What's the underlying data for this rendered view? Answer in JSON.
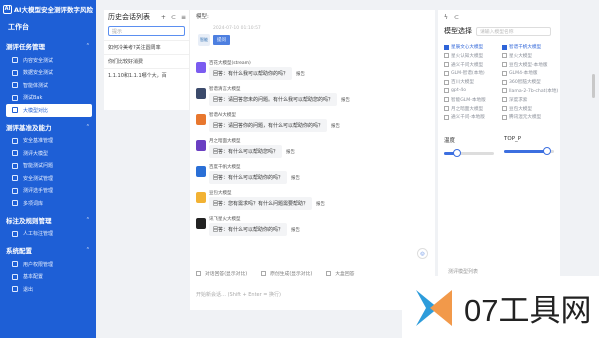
{
  "brand": {
    "logo_text": "AI",
    "title": "AI大模型安全测评数字风险"
  },
  "workbench": "工作台",
  "sidebar": {
    "groups": [
      {
        "title": "测评任务管理",
        "items": [
          {
            "label": "内容安全测试"
          },
          {
            "label": "数据安全测试"
          },
          {
            "label": "智能体测试"
          },
          {
            "label": "测试Bak"
          },
          {
            "label": "大模型对比",
            "active": true
          }
        ]
      },
      {
        "title": "测评基准及能力",
        "items": [
          {
            "label": "安全基准管理"
          },
          {
            "label": "测评大模型"
          },
          {
            "label": "智能测试问题"
          },
          {
            "label": "安全测试管理"
          },
          {
            "label": "测评选手管理"
          },
          {
            "label": "多项词库"
          }
        ]
      },
      {
        "title": "标注及规则管理",
        "items": [
          {
            "label": "人工标注管理"
          }
        ]
      },
      {
        "title": "系统配置",
        "items": [
          {
            "label": "用户权限管理"
          },
          {
            "label": "基本配置"
          },
          {
            "label": "退出"
          }
        ]
      }
    ]
  },
  "history": {
    "title": "历史会话列表",
    "tools": [
      "+",
      "⊂",
      "≡"
    ],
    "search_placeholder": "提示",
    "items": [
      "如何冷美考?关注圆周率",
      "你们比较好消费",
      "1.1.10和1.1.1哪个大，百"
    ]
  },
  "chat": {
    "header": "模型:",
    "system": {
      "logo_text": "智能",
      "time": "2024-07-10 01:10:57",
      "badge": "提问"
    },
    "messages": [
      {
        "model": "百花大模型(stream)",
        "text": "回答：有什么我可以帮助你的吗？",
        "tag": "报告",
        "avatar_color": "#7b5cf0"
      },
      {
        "model": "智谱清言大模型",
        "text": "回答：请回答您未的问题。有什么我可以帮助您的吗？",
        "tag": "报告",
        "avatar_color": "#3b4a6b"
      },
      {
        "model": "智谱AI大模型",
        "text": "回答：请回答你的问题，有什么可以帮助你的吗？",
        "tag": "报告",
        "avatar_color": "#e8772e"
      },
      {
        "model": "月之暗面大模型",
        "text": "回答：有什么可以帮助您吗？",
        "tag": "报告",
        "avatar_color": "#6a3fc2"
      },
      {
        "model": "百度千帆大模型",
        "text": "回答：有什么可以帮助你的吗？",
        "tag": "报告",
        "avatar_color": "#2a6fd6"
      },
      {
        "model": "豆包大模型",
        "text": "回答：您有需求吗？有什么问题需要帮助？",
        "tag": "报告",
        "avatar_color": "#f2b233"
      },
      {
        "model": "讯飞星火大模型",
        "text": "回答：有什么可以帮助你的吗？",
        "tag": "报告",
        "avatar_color": "#222222"
      }
    ],
    "compare_options": [
      "对话回答(显示对比)",
      "原创生成(显示对比)",
      "大盒回答"
    ],
    "input_hint": "开始新会话… (Shift + Enter = 换行)",
    "round_button": "◎"
  },
  "right_panel": {
    "tools": [
      "ϟ",
      "⊂"
    ],
    "title": "模型选择",
    "search_placeholder": "请输入模型名称",
    "models": [
      {
        "label": "星辰文心大模型",
        "checked": true
      },
      {
        "label": "智谱千帆大模型",
        "checked": true
      },
      {
        "label": "星火认知大模型",
        "checked": false
      },
      {
        "label": "星火大模型",
        "checked": false
      },
      {
        "label": "通义千问大模型",
        "checked": false
      },
      {
        "label": "豆包大模型-本地版",
        "checked": false
      },
      {
        "label": "GLM-智谱(本地)",
        "checked": false
      },
      {
        "label": "GLM4-本地版",
        "checked": false
      },
      {
        "label": "百川大模型",
        "checked": false
      },
      {
        "label": "360智脑大模型",
        "checked": false
      },
      {
        "label": "gpt-4o",
        "checked": false
      },
      {
        "label": "llama-2-7b-chat(本地)",
        "checked": false
      },
      {
        "label": "智能GLM-本地版",
        "checked": false
      },
      {
        "label": "深度求索",
        "checked": false
      },
      {
        "label": "月之暗面大模型",
        "checked": false
      },
      {
        "label": "豆包大模型",
        "checked": false
      },
      {
        "label": "通义千问-本地版",
        "checked": false
      },
      {
        "label": "腾讯混元大模型",
        "checked": false
      }
    ],
    "sliders": [
      {
        "name": "温度",
        "value": 0.25
      },
      {
        "name": "TOP_P",
        "value": 0.85
      }
    ],
    "bottom_label": "测评模型列表"
  },
  "watermark": {
    "text": "07工具网",
    "colors": [
      "#2d9cdb",
      "#f2994a"
    ]
  }
}
